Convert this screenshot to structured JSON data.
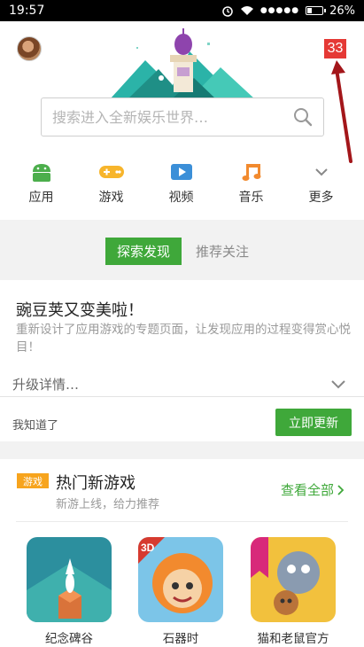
{
  "status_bar": {
    "time": "19:57",
    "battery_percent": "26%",
    "signal_dots": "●●●●●"
  },
  "header": {
    "badge_count": "33",
    "search_placeholder": "搜索进入全新娱乐世界…"
  },
  "categories": [
    {
      "label": "应用",
      "icon": "android-icon",
      "color": "#4cae4c"
    },
    {
      "label": "游戏",
      "icon": "gamepad-icon",
      "color": "#f7b52c"
    },
    {
      "label": "视频",
      "icon": "video-play-icon",
      "color": "#3b8fd8"
    },
    {
      "label": "音乐",
      "icon": "music-note-icon",
      "color": "#f28a2e"
    },
    {
      "label": "更多",
      "icon": "chevron-down-icon",
      "color": "#888888"
    }
  ],
  "tabs": {
    "active": "探索发现",
    "inactive": "推荐关注"
  },
  "update_card": {
    "title": "豌豆荚又变美啦！",
    "description": "重新设计了应用游戏的专题页面，让发现应用的过程变得赏心悦目！",
    "details_label": "升级详情…",
    "dismiss_label": "我知道了",
    "update_button": "立即更新"
  },
  "hot_games": {
    "tag": "游戏",
    "title": "热门新游戏",
    "subtitle": "新游上线，给力推荐",
    "view_all": "查看全部",
    "apps": [
      {
        "name": "纪念碑谷"
      },
      {
        "name": "石器时"
      },
      {
        "name": "猫和老鼠官方"
      }
    ]
  },
  "colors": {
    "accent_green": "#3fa83a",
    "badge_red": "#e53935",
    "tag_orange": "#f7a41d"
  }
}
